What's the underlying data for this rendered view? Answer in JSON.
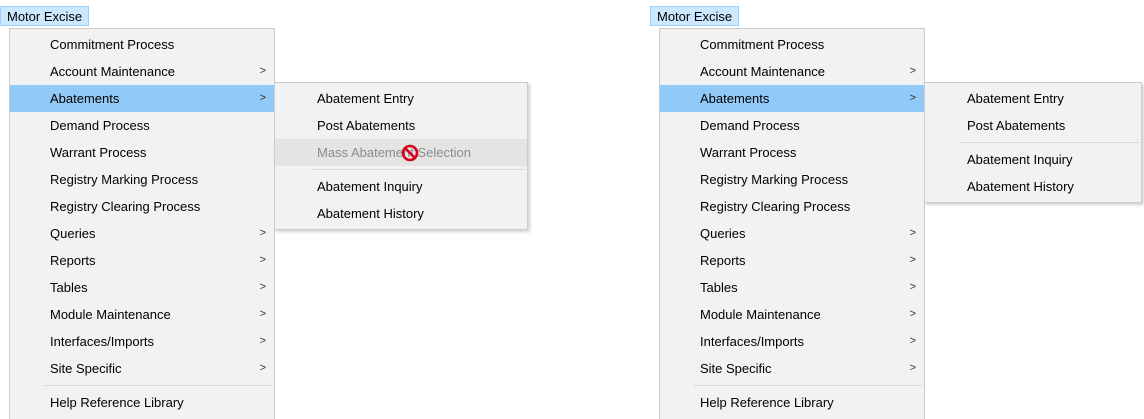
{
  "menubar": {
    "title": "Motor Excise"
  },
  "menu": {
    "items": [
      {
        "label": "Commitment Process",
        "submenu": false
      },
      {
        "label": "Account Maintenance",
        "submenu": true
      },
      {
        "label": "Abatements",
        "submenu": true
      },
      {
        "label": "Demand Process",
        "submenu": false
      },
      {
        "label": "Warrant Process",
        "submenu": false
      },
      {
        "label": "Registry Marking Process",
        "submenu": false
      },
      {
        "label": "Registry Clearing Process",
        "submenu": false
      },
      {
        "label": "Queries",
        "submenu": true
      },
      {
        "label": "Reports",
        "submenu": true
      },
      {
        "label": "Tables",
        "submenu": true
      },
      {
        "label": "Module Maintenance",
        "submenu": true
      },
      {
        "label": "Interfaces/Imports",
        "submenu": true
      },
      {
        "label": "Site Specific",
        "submenu": true
      }
    ],
    "footer_item": "Help Reference Library",
    "arrow_glyph": ">"
  },
  "left_submenu": {
    "entry": "Abatement Entry",
    "post": "Post Abatements",
    "mass": "Mass Abatement Selection",
    "inquiry": "Abatement Inquiry",
    "history": "Abatement History"
  },
  "right_submenu": {
    "entry": "Abatement Entry",
    "post": "Post Abatements",
    "inquiry": "Abatement Inquiry",
    "history": "Abatement History"
  },
  "colors": {
    "highlight": "#91c9f7",
    "menubar_bg": "#cce8ff",
    "menu_bg": "#f2f2f2",
    "disabled_text": "#8c8c8c",
    "no_icon": "#d9001b"
  }
}
